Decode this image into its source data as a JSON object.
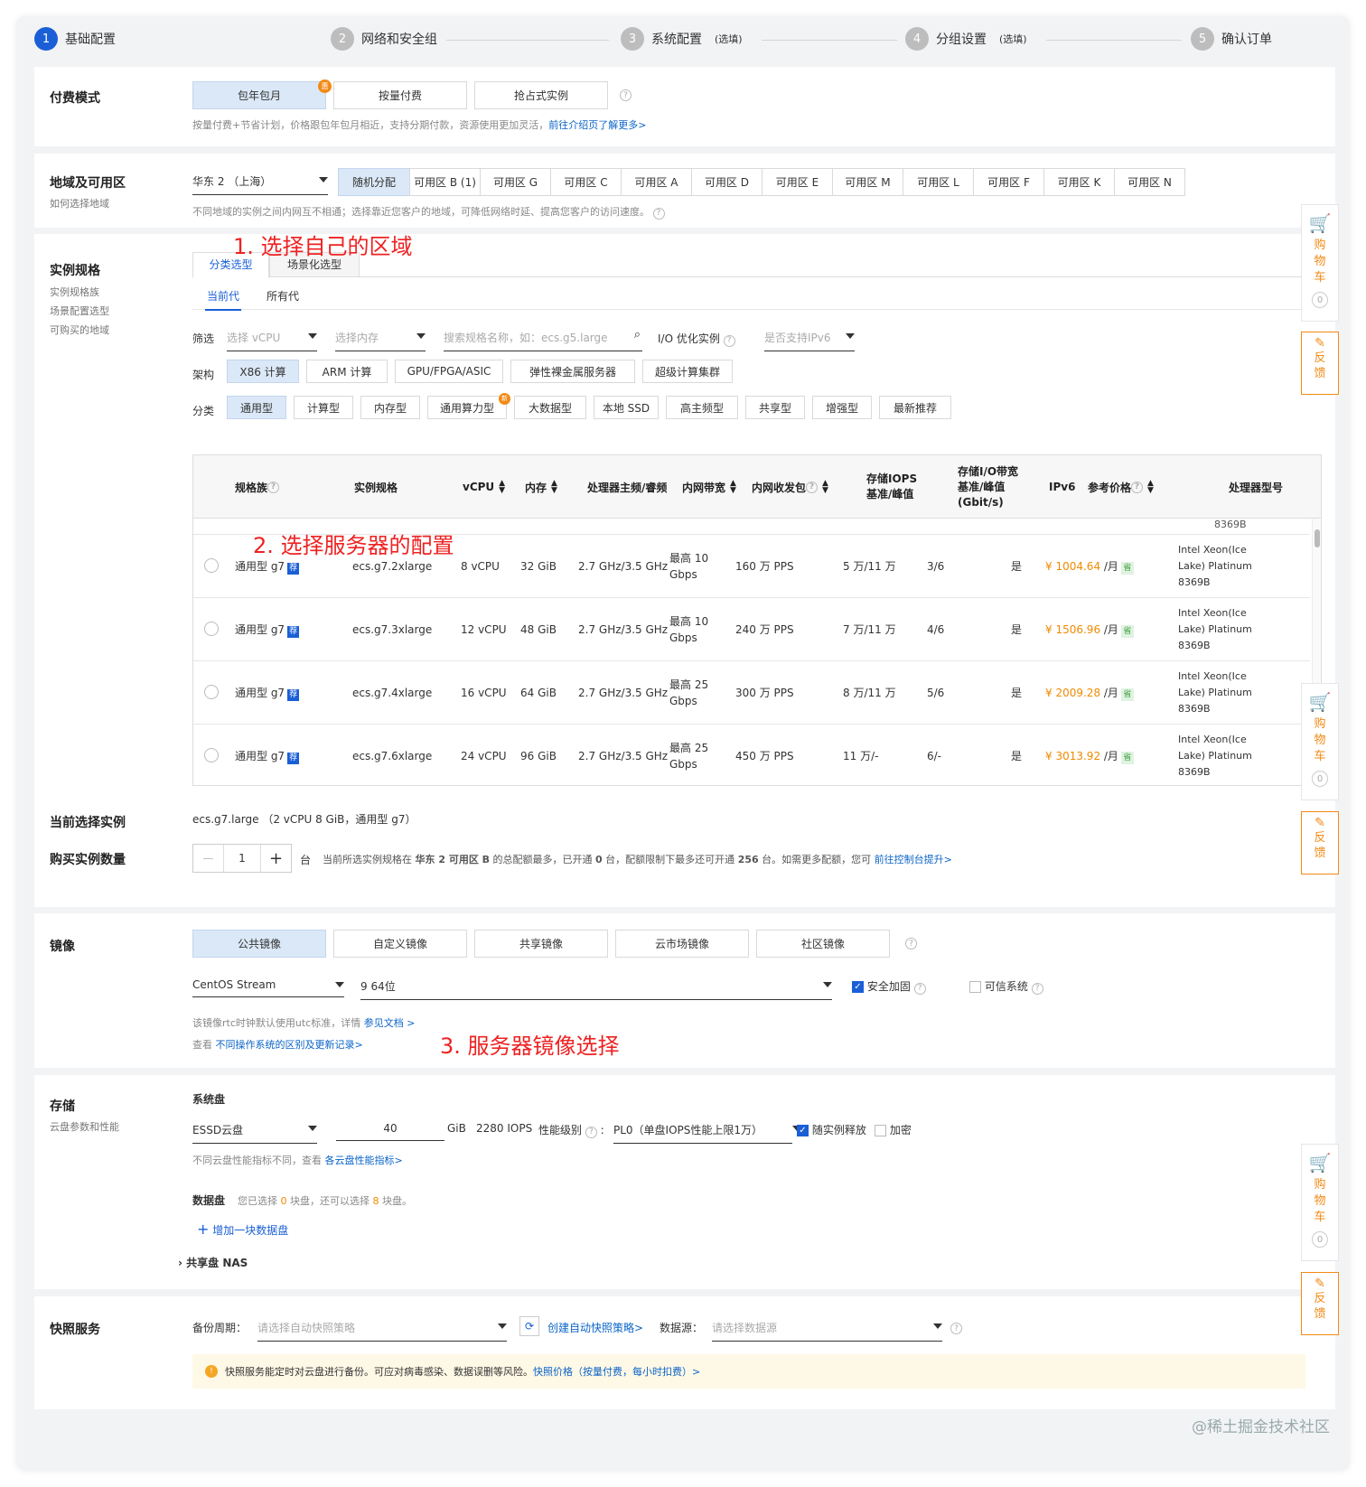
{
  "steps": [
    {
      "num": "1",
      "label": "基础配置",
      "opt": ""
    },
    {
      "num": "2",
      "label": "网络和安全组",
      "opt": ""
    },
    {
      "num": "3",
      "label": "系统配置",
      "opt": "(选填)"
    },
    {
      "num": "4",
      "label": "分组设置",
      "opt": "(选填)"
    },
    {
      "num": "5",
      "label": "确认订单",
      "opt": ""
    }
  ],
  "billing": {
    "title": "付费模式",
    "options": [
      "包年包月",
      "按量付费",
      "抢占式实例"
    ],
    "badge": "惠",
    "help": "?",
    "desc": "按量付费+节省计划，价格跟包年包月相近，支持分期付款，资源使用更加灵活，",
    "desc_link": "前往介绍页了解更多>"
  },
  "region": {
    "title": "地域及可用区",
    "sub": "如何选择地域",
    "select": "华东 2 （上海）",
    "zones": [
      "随机分配",
      "可用区 B (1)",
      "可用区 G",
      "可用区 C",
      "可用区 A",
      "可用区 D",
      "可用区 E",
      "可用区 M",
      "可用区 L",
      "可用区 F",
      "可用区 K",
      "可用区 N"
    ],
    "desc": "不同地域的实例之间内网互不相通；选择靠近您客户的地域，可降低网络时延、提高您客户的访问速度。"
  },
  "annotations": {
    "a1": "1. 选择自己的区域",
    "a2": "2. 选择服务器的配置",
    "a3": "3. 服务器镜像选择"
  },
  "spec": {
    "title": "实例规格",
    "sub1": "实例规格族",
    "sub2": "场景配置选型",
    "sub3": "可购买的地域",
    "tabs": [
      "分类选型",
      "场景化选型"
    ],
    "gen_tabs": [
      "当前代",
      "所有代"
    ],
    "filter_label": "筛选",
    "vcpu_ph": "选择 vCPU",
    "mem_ph": "选择内存",
    "search_ph": "搜索规格名称，如：ecs.g5.large",
    "io_label": "I/O 优化实例",
    "ipv6_ph": "是否支持IPv6",
    "arch_label": "架构",
    "archs": [
      "X86 计算",
      "ARM 计算",
      "GPU/FPGA/ASIC",
      "弹性裸金属服务器",
      "超级计算集群"
    ],
    "cat_label": "分类",
    "cats": [
      "通用型",
      "计算型",
      "内存型",
      "通用算力型",
      "大数据型",
      "本地 SSD",
      "高主频型",
      "共享型",
      "增强型",
      "最新推荐"
    ],
    "cat_badge": "新",
    "headers": [
      "规格族",
      "实例规格",
      "vCPU",
      "内存",
      "处理器主频/睿频",
      "内网带宽",
      "内网收发包",
      "存储IOPS\n基准/峰值",
      "存储I/O带宽\n基准/峰值\n(Gbit/s)",
      "IPv6",
      "参考价格",
      "处理器型号"
    ],
    "partial_top": "8369B",
    "rows": [
      {
        "family": "通用型 g7",
        "rec": "荐",
        "spec": "ecs.g7.2xlarge",
        "vcpu": "8 vCPU",
        "mem": "32 GiB",
        "freq": "2.7 GHz/3.5 GHz",
        "bw1": "最高 10",
        "bw2": "Gbps",
        "pps": "160 万 PPS",
        "iops": "5 万/11 万",
        "io": "3/6",
        "ipv6": "是",
        "price": "¥ 1004.64",
        "unit": " /月",
        "save": "省",
        "cpu1": "Intel Xeon(Ice",
        "cpu2": "Lake) Platinum",
        "cpu3": "8369B"
      },
      {
        "family": "通用型 g7",
        "rec": "荐",
        "spec": "ecs.g7.3xlarge",
        "vcpu": "12 vCPU",
        "mem": "48 GiB",
        "freq": "2.7 GHz/3.5 GHz",
        "bw1": "最高 10",
        "bw2": "Gbps",
        "pps": "240 万 PPS",
        "iops": "7 万/11 万",
        "io": "4/6",
        "ipv6": "是",
        "price": "¥ 1506.96",
        "unit": " /月",
        "save": "省",
        "cpu1": "Intel Xeon(Ice",
        "cpu2": "Lake) Platinum",
        "cpu3": "8369B"
      },
      {
        "family": "通用型 g7",
        "rec": "荐",
        "spec": "ecs.g7.4xlarge",
        "vcpu": "16 vCPU",
        "mem": "64 GiB",
        "freq": "2.7 GHz/3.5 GHz",
        "bw1": "最高 25",
        "bw2": "Gbps",
        "pps": "300 万 PPS",
        "iops": "8 万/11 万",
        "io": "5/6",
        "ipv6": "是",
        "price": "¥ 2009.28",
        "unit": " /月",
        "save": "省",
        "cpu1": "Intel Xeon(Ice",
        "cpu2": "Lake) Platinum",
        "cpu3": "8369B"
      },
      {
        "family": "通用型 g7",
        "rec": "荐",
        "spec": "ecs.g7.6xlarge",
        "vcpu": "24 vCPU",
        "mem": "96 GiB",
        "freq": "2.7 GHz/3.5 GHz",
        "bw1": "最高 25",
        "bw2": "Gbps",
        "pps": "450 万 PPS",
        "iops": "11 万/-",
        "io": "6/-",
        "ipv6": "是",
        "price": "¥ 3013.92",
        "unit": " /月",
        "save": "省",
        "cpu1": "Intel Xeon(Ice",
        "cpu2": "Lake) Platinum",
        "cpu3": "8369B"
      }
    ],
    "current_label": "当前选择实例",
    "current_value": "ecs.g7.large （2 vCPU 8 GiB，通用型 g7）",
    "qty_label": "购买实例数量",
    "qty_minus": "—",
    "qty_value": "1",
    "qty_plus": "+",
    "qty_unit": "台",
    "qty_desc1": "当前所选实例规格在 ",
    "qty_desc_bold1": "华东 2 可用区 B",
    "qty_desc2": " 的总配额最多，已开通 ",
    "qty_desc_bold2": "0",
    "qty_desc3": " 台，配额限制下最多还可开通 ",
    "qty_desc_bold3": "256",
    "qty_desc4": " 台。如需更多配额，您可 ",
    "qty_link": "前往控制台提升>"
  },
  "image": {
    "title": "镜像",
    "tabs": [
      "公共镜像",
      "自定义镜像",
      "共享镜像",
      "云市场镜像",
      "社区镜像"
    ],
    "os": "CentOS Stream",
    "version": "9 64位",
    "security": "安全加固",
    "trusted": "可信系统",
    "note1": "该镜像rtc时钟默认使用utc标准，详情 ",
    "note1_link": "参见文档 >",
    "note2": "查看 ",
    "note2_link": "不同操作系统的区别及更新记录>"
  },
  "storage": {
    "title": "存储",
    "sub": "云盘参数和性能",
    "sys_label": "系统盘",
    "disk_type": "ESSD云盘",
    "size": "40",
    "unit": "GiB",
    "iops": "2280 IOPS",
    "perf_label": "性能级别",
    "perf_value": "PL0（单盘IOPS性能上限1万）",
    "release": "随实例释放",
    "encrypt": "加密",
    "note": "不同云盘性能指标不同，查看 ",
    "note_link": "各云盘性能指标>",
    "data_label": "数据盘",
    "data_desc1": "您已选择 ",
    "data_n1": "0",
    "data_desc2": " 块盘，还可以选择 ",
    "data_n2": "8",
    "data_desc3": " 块盘。",
    "add": "增加一块数据盘",
    "nas": "共享盘 NAS"
  },
  "snapshot": {
    "title": "快照服务",
    "period_label": "备份周期：",
    "period_ph": "请选择自动快照策略",
    "create": "创建自动快照策略>",
    "source_label": "数据源：",
    "source_ph": "请选择数据源",
    "notice": "快照服务能定时对云盘进行备份。可应对病毒感染、数据误删等风险。",
    "notice_link": "快照价格（按量付费，每小时扣费）>"
  },
  "sidebar": {
    "cart": "购\n物\n车",
    "cart_count": "0",
    "feedback": "反\n馈"
  },
  "watermark": "@稀土掘金技术社区",
  "colors": {
    "primary": "#1a5fd6",
    "price": "#f08a00",
    "annotation": "#e22"
  }
}
